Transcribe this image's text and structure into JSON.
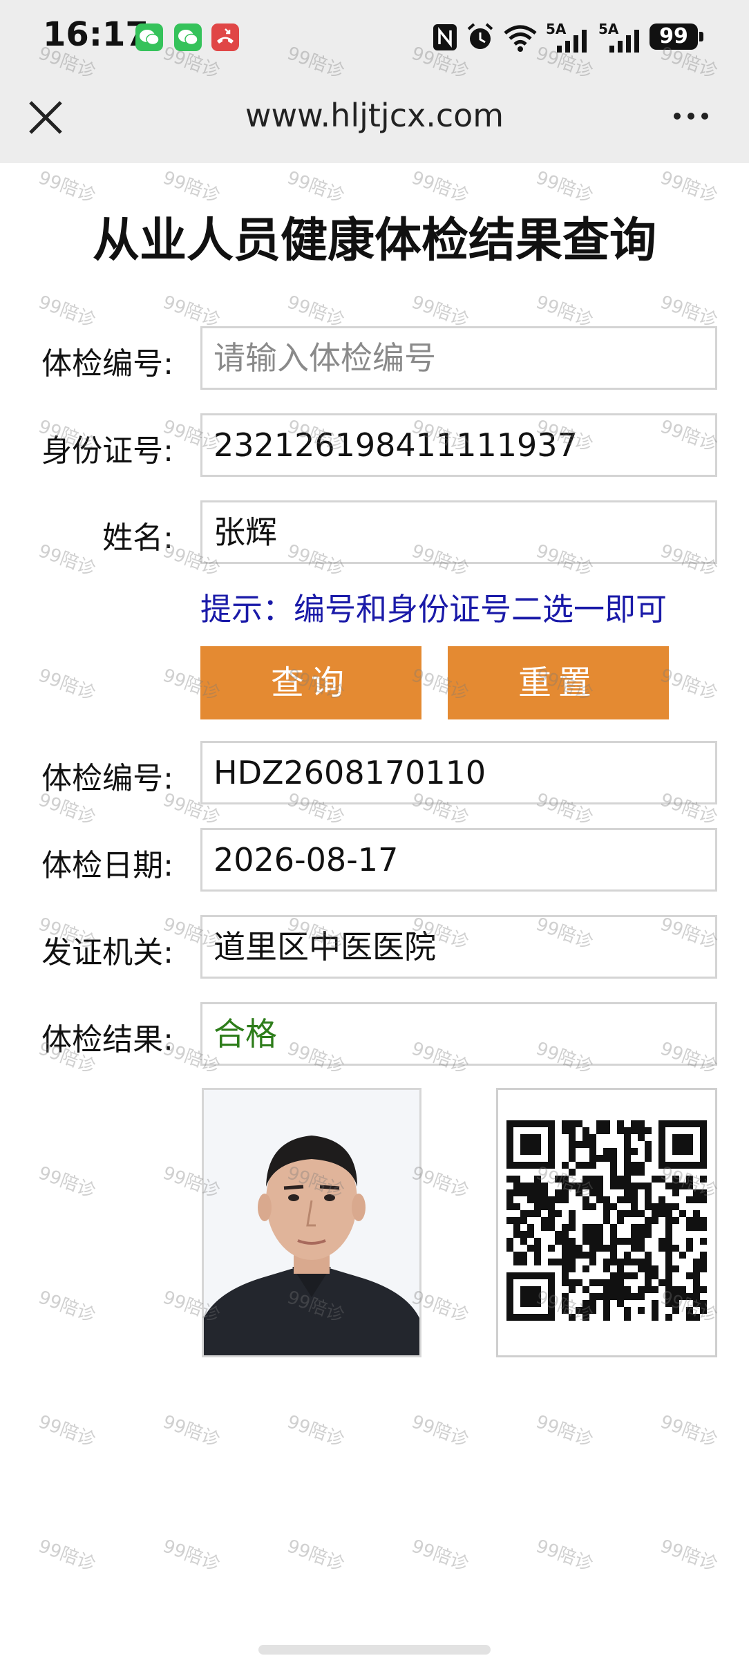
{
  "status_bar": {
    "time": "16:17",
    "apps": [
      "wechat-icon",
      "wechat-icon",
      "missed-call-icon"
    ],
    "system_icons": [
      "nfc-icon",
      "alarm-icon",
      "wifi-icon",
      "signal-5a-icon",
      "signal-5a-icon"
    ],
    "signal_label": "5A",
    "battery": "99"
  },
  "browser": {
    "url": "www.hljtjcx.com",
    "close_icon": "close-icon",
    "more_icon": "more-icon"
  },
  "page": {
    "title": "从业人员健康体检结果查询",
    "form": {
      "exam_no_label": "体检编号:",
      "exam_no_placeholder": "请输入体检编号",
      "exam_no_value": "",
      "id_label": "身份证号:",
      "id_value": "232126198411111937",
      "name_label": "姓名:",
      "name_value": "张辉",
      "hint": "提示：编号和身份证号二选一即可",
      "query_button": "查询",
      "reset_button": "重置"
    },
    "result": {
      "exam_no_label": "体检编号:",
      "exam_no_value": "HDZ2608170110",
      "date_label": "体检日期:",
      "date_value": "2026-08-17",
      "issuer_label": "发证机关:",
      "issuer_value": "道里区中医医院",
      "result_label": "体检结果:",
      "result_value": "合格"
    },
    "watermark": "99陪诊",
    "colors": {
      "button": "#e48a32",
      "hint": "#1a1aa8",
      "result_ok": "#2d7d1a"
    }
  }
}
